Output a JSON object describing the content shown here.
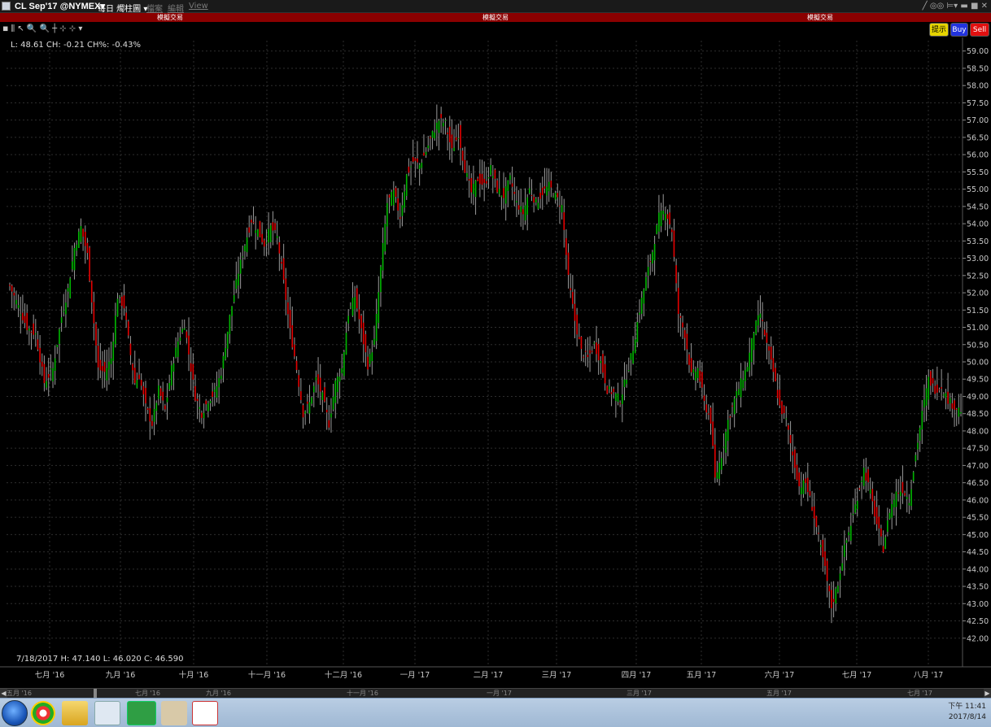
{
  "titlebar": {
    "symbol": "CL Sep'17 @NYMEX▾",
    "chart_type": "每日 燭柱圖 ▾",
    "menu": [
      "檔案",
      "編輯",
      "View"
    ],
    "window_controls": "╱ ◎◎ ⊨▾ ▬ ■ ✕"
  },
  "simbar": {
    "label": "模擬交易"
  },
  "toolbar": {
    "tools": "◾ ⫼ ↖ 🔍 🔍 ┼ ⊹ ⊹ ▾",
    "show_label": "提示",
    "buy_label": "Buy",
    "sell_label": "Sell"
  },
  "chart": {
    "header_readout": "L: 48.61 CH: -0.21 CH%: -0.43%",
    "bar_readout": "7/18/2017   H: 47.140   L: 46.020   C: 46.590",
    "colors": {
      "up": "#00b300",
      "down": "#e00000",
      "grid": "#2e2e2e",
      "axis_text": "#c8c8c8"
    }
  },
  "chart_data": {
    "type": "candlestick",
    "y_ticks": [
      "59.00",
      "58.50",
      "58.00",
      "57.50",
      "57.00",
      "56.50",
      "56.00",
      "55.50",
      "55.00",
      "54.50",
      "54.00",
      "53.50",
      "53.00",
      "52.50",
      "52.00",
      "51.50",
      "51.00",
      "50.50",
      "50.00",
      "49.50",
      "49.00",
      "48.50",
      "48.00",
      "47.50",
      "47.00",
      "46.50",
      "46.00",
      "45.50",
      "45.00",
      "44.50",
      "44.00",
      "43.50",
      "43.00",
      "42.50",
      "42.00"
    ],
    "ylim": [
      41.5,
      59.3
    ],
    "x_ticks": [
      "七月 '16",
      "九月 '16",
      "十月 '16",
      "十一月 '16",
      "十二月 '16",
      "一月 '17",
      "二月 '17",
      "三月 '17",
      "四月 '17",
      "五月 '17",
      "六月 '17",
      "七月 '17",
      "八月 '17"
    ],
    "close_path": [
      [
        0,
        52.2
      ],
      [
        4,
        51.6
      ],
      [
        8,
        51.0
      ],
      [
        12,
        50.8
      ],
      [
        16,
        49.4
      ],
      [
        20,
        49.8
      ],
      [
        24,
        51.3
      ],
      [
        27,
        52.1
      ],
      [
        30,
        53.3
      ],
      [
        33,
        53.9
      ],
      [
        36,
        53.1
      ],
      [
        38,
        51.8
      ],
      [
        41,
        49.8
      ],
      [
        44,
        49.7
      ],
      [
        47,
        50.1
      ],
      [
        50,
        51.9
      ],
      [
        53,
        51.6
      ],
      [
        56,
        50.2
      ],
      [
        58,
        49.4
      ],
      [
        60,
        49.6
      ],
      [
        63,
        48.7
      ],
      [
        66,
        48.2
      ],
      [
        69,
        49.2
      ],
      [
        72,
        48.6
      ],
      [
        75,
        49.8
      ],
      [
        78,
        50.6
      ],
      [
        81,
        51.1
      ],
      [
        84,
        49.8
      ],
      [
        86,
        49.0
      ],
      [
        89,
        48.5
      ],
      [
        92,
        48.9
      ],
      [
        95,
        49.1
      ],
      [
        98,
        49.7
      ],
      [
        102,
        51.3
      ],
      [
        106,
        52.6
      ],
      [
        109,
        53.4
      ],
      [
        112,
        54.1
      ],
      [
        115,
        53.8
      ],
      [
        118,
        53.4
      ],
      [
        121,
        53.9
      ],
      [
        124,
        53.6
      ],
      [
        127,
        52.3
      ],
      [
        130,
        50.9
      ],
      [
        133,
        49.8
      ],
      [
        136,
        48.5
      ],
      [
        139,
        48.8
      ],
      [
        142,
        49.5
      ],
      [
        145,
        49.0
      ],
      [
        148,
        48.2
      ],
      [
        151,
        49.4
      ],
      [
        154,
        49.8
      ],
      [
        157,
        51.4
      ],
      [
        160,
        51.9
      ],
      [
        163,
        50.9
      ],
      [
        166,
        49.9
      ],
      [
        169,
        50.6
      ],
      [
        172,
        52.7
      ],
      [
        175,
        54.6
      ],
      [
        178,
        54.9
      ],
      [
        181,
        54.2
      ],
      [
        184,
        55.4
      ],
      [
        187,
        55.8
      ],
      [
        190,
        55.7
      ],
      [
        193,
        56.1
      ],
      [
        196,
        56.6
      ],
      [
        199,
        57.0
      ],
      [
        202,
        56.9
      ],
      [
        205,
        56.1
      ],
      [
        208,
        56.6
      ],
      [
        211,
        55.6
      ],
      [
        214,
        54.9
      ],
      [
        217,
        55.3
      ],
      [
        220,
        55.1
      ],
      [
        223,
        55.6
      ],
      [
        226,
        55.0
      ],
      [
        229,
        54.8
      ],
      [
        232,
        55.3
      ],
      [
        235,
        54.6
      ],
      [
        238,
        54.3
      ],
      [
        241,
        55.0
      ],
      [
        244,
        54.6
      ],
      [
        247,
        54.9
      ],
      [
        250,
        55.1
      ],
      [
        253,
        54.8
      ],
      [
        256,
        54.5
      ],
      [
        259,
        52.4
      ],
      [
        262,
        51.2
      ],
      [
        265,
        50.3
      ],
      [
        268,
        50.1
      ],
      [
        271,
        50.5
      ],
      [
        274,
        50.0
      ],
      [
        277,
        49.2
      ],
      [
        280,
        49.1
      ],
      [
        283,
        48.9
      ],
      [
        286,
        49.6
      ],
      [
        289,
        50.4
      ],
      [
        292,
        51.5
      ],
      [
        295,
        52.4
      ],
      [
        298,
        53.2
      ],
      [
        301,
        54.2
      ],
      [
        304,
        54.4
      ],
      [
        307,
        53.8
      ],
      [
        310,
        51.4
      ],
      [
        313,
        50.8
      ],
      [
        316,
        49.6
      ],
      [
        319,
        49.8
      ],
      [
        322,
        48.8
      ],
      [
        325,
        48.3
      ],
      [
        327,
        46.6
      ],
      [
        330,
        47.3
      ],
      [
        333,
        48.3
      ],
      [
        336,
        48.9
      ],
      [
        339,
        49.4
      ],
      [
        342,
        49.9
      ],
      [
        345,
        50.9
      ],
      [
        348,
        51.4
      ],
      [
        351,
        50.5
      ],
      [
        354,
        49.7
      ],
      [
        357,
        48.7
      ],
      [
        360,
        48.3
      ],
      [
        363,
        47.3
      ],
      [
        366,
        46.4
      ],
      [
        369,
        46.5
      ],
      [
        372,
        45.8
      ],
      [
        375,
        44.9
      ],
      [
        378,
        44.0
      ],
      [
        381,
        42.9
      ],
      [
        384,
        43.6
      ],
      [
        387,
        44.6
      ],
      [
        390,
        45.3
      ],
      [
        393,
        46.1
      ],
      [
        396,
        46.9
      ],
      [
        399,
        46.2
      ],
      [
        402,
        45.3
      ],
      [
        405,
        44.6
      ],
      [
        408,
        45.7
      ],
      [
        411,
        46.2
      ],
      [
        414,
        46.3
      ],
      [
        417,
        46.0
      ],
      [
        420,
        47.3
      ],
      [
        423,
        48.5
      ],
      [
        426,
        49.5
      ],
      [
        429,
        49.2
      ],
      [
        432,
        49.3
      ],
      [
        435,
        48.9
      ],
      [
        438,
        48.7
      ],
      [
        441,
        48.6
      ]
    ]
  },
  "scrollbar": {
    "labels": [
      "五月 '16",
      "七月 '16",
      "九月 '16",
      "十一月 '16",
      "一月 '17",
      "三月 '17",
      "五月 '17",
      "七月 '17"
    ]
  },
  "taskbar": {
    "clock_time": "下午 11:41",
    "clock_date": "2017/8/14"
  }
}
